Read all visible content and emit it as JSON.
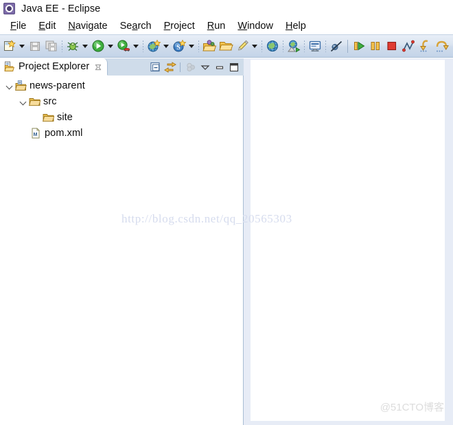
{
  "window": {
    "title": "Java EE - Eclipse",
    "app_icon": "eclipse-icon"
  },
  "menubar": {
    "items": [
      {
        "label": "File",
        "mnemonic": "F",
        "rest": "ile"
      },
      {
        "label": "Edit",
        "mnemonic": "E",
        "rest": "dit"
      },
      {
        "label": "Navigate",
        "mnemonic": "N",
        "rest": "avigate"
      },
      {
        "label": "Search",
        "pre": "Se",
        "mnemonic": "a",
        "rest": "rch"
      },
      {
        "label": "Project",
        "mnemonic": "P",
        "rest": "roject"
      },
      {
        "label": "Run",
        "mnemonic": "R",
        "rest": "un"
      },
      {
        "label": "Window",
        "mnemonic": "W",
        "rest": "indow"
      },
      {
        "label": "Help",
        "mnemonic": "H",
        "rest": "elp"
      }
    ]
  },
  "toolbar": {
    "items": [
      {
        "name": "new-wizard-icon",
        "kind": "icon",
        "enabled": true
      },
      {
        "name": "new-wizard-dropdown-icon",
        "kind": "arrow"
      },
      {
        "name": "save-icon",
        "kind": "icon",
        "enabled": false
      },
      {
        "name": "save-all-icon",
        "kind": "icon",
        "enabled": false
      },
      {
        "name": "separator",
        "kind": "sep"
      },
      {
        "name": "debug-icon",
        "kind": "icon",
        "enabled": true
      },
      {
        "name": "debug-dropdown-icon",
        "kind": "arrow"
      },
      {
        "name": "run-icon",
        "kind": "icon",
        "enabled": true
      },
      {
        "name": "run-dropdown-icon",
        "kind": "arrow"
      },
      {
        "name": "run-external-tools-icon",
        "kind": "icon",
        "enabled": true
      },
      {
        "name": "run-external-tools-dropdown-icon",
        "kind": "arrow"
      },
      {
        "name": "separator",
        "kind": "sep"
      },
      {
        "name": "new-java-ee-project-icon",
        "kind": "icon",
        "enabled": true
      },
      {
        "name": "new-java-ee-dropdown-icon",
        "kind": "arrow"
      },
      {
        "name": "new-server-icon",
        "kind": "icon",
        "enabled": true
      },
      {
        "name": "new-server-dropdown-icon",
        "kind": "arrow"
      },
      {
        "name": "separator",
        "kind": "sep"
      },
      {
        "name": "open-type-icon",
        "kind": "icon",
        "enabled": true
      },
      {
        "name": "open-task-icon",
        "kind": "icon",
        "enabled": true
      },
      {
        "name": "new-annotation-icon",
        "kind": "icon",
        "enabled": true
      },
      {
        "name": "new-annotation-dropdown-icon",
        "kind": "arrow"
      },
      {
        "name": "separator",
        "kind": "sep"
      },
      {
        "name": "web-browser-icon",
        "kind": "icon",
        "enabled": true
      },
      {
        "name": "separator",
        "kind": "sep"
      },
      {
        "name": "run-last-tool-icon",
        "kind": "icon",
        "enabled": true
      },
      {
        "name": "separator",
        "kind": "sep"
      },
      {
        "name": "console-icon",
        "kind": "icon",
        "enabled": true
      },
      {
        "name": "separator",
        "kind": "sep"
      },
      {
        "name": "skip-breakpoints-icon",
        "kind": "icon",
        "enabled": true
      },
      {
        "name": "separator-solid",
        "kind": "sep-solid"
      },
      {
        "name": "resume-icon",
        "kind": "icon",
        "enabled": true
      },
      {
        "name": "suspend-icon",
        "kind": "icon",
        "enabled": true
      },
      {
        "name": "terminate-icon",
        "kind": "icon",
        "enabled": true
      },
      {
        "name": "disconnect-icon",
        "kind": "icon",
        "enabled": true
      },
      {
        "name": "step-into-icon",
        "kind": "icon",
        "enabled": true
      },
      {
        "name": "step-over-icon",
        "kind": "icon",
        "enabled": true
      }
    ]
  },
  "explorer": {
    "tab": {
      "label": "Project Explorer",
      "icon": "project-explorer-icon",
      "close_icon": "close-icon"
    },
    "tools": [
      {
        "name": "collapse-all-icon",
        "enabled": true
      },
      {
        "name": "link-with-editor-icon",
        "enabled": true
      },
      {
        "name": "separator",
        "enabled": false
      },
      {
        "name": "focus-on-active-task-icon",
        "enabled": false
      },
      {
        "name": "view-menu-icon",
        "enabled": true
      },
      {
        "name": "minimize-icon",
        "enabled": true
      },
      {
        "name": "maximize-icon",
        "enabled": true
      }
    ],
    "tree": [
      {
        "label": "news-parent",
        "icon": "maven-project-icon",
        "depth": 0,
        "expanded": true,
        "has_twisty": true
      },
      {
        "label": "src",
        "icon": "folder-icon",
        "depth": 1,
        "expanded": true,
        "has_twisty": true
      },
      {
        "label": "site",
        "icon": "folder-icon",
        "depth": 2,
        "expanded": false,
        "has_twisty": false
      },
      {
        "label": "pom.xml",
        "icon": "maven-pom-file-icon",
        "depth": 1,
        "expanded": false,
        "has_twisty": false
      }
    ]
  },
  "editor": {
    "content": ""
  },
  "watermarks": {
    "url": "http://blog.csdn.net/qq_20565303",
    "brand": "@51CTO博客"
  },
  "colors": {
    "toolbar_top": "#e8eef7",
    "toolbar_bottom": "#c4d4e8",
    "tab_row": "#cfdcea",
    "panel_border": "#a8bdd4",
    "editor_bg": "#e7ecf6",
    "text": "#0c0c0c",
    "watermark_url": "#d6dcee",
    "watermark_brand": "#dcdcdc"
  }
}
